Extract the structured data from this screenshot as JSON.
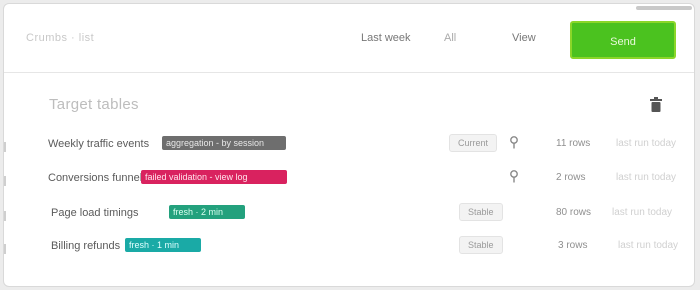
{
  "header": {
    "breadcrumb": "Crumbs · list",
    "item_a": "Last week",
    "item_b": "All",
    "item_c": "View",
    "primary_label": "Send"
  },
  "section": {
    "title": "Target tables"
  },
  "rows": [
    {
      "name": "Weekly traffic events",
      "tag": "aggregation - by session",
      "tag_color": "#6e6e6e",
      "pill": "Current",
      "value": "11 rows",
      "extra": "last run today"
    },
    {
      "name": "Conversions funnel",
      "tag": "failed validation - view log",
      "tag_color": "#d9225f",
      "pill": "",
      "value": "2 rows",
      "extra": "last run today"
    },
    {
      "name": "Page load timings",
      "tag": "fresh · 2 min",
      "tag_color": "#23a17d",
      "pill": "Stable",
      "value": "80 rows",
      "extra": "last run today"
    },
    {
      "name": "Billing refunds",
      "tag": "fresh · 1 min",
      "tag_color": "#1aaaa6",
      "pill": "Stable",
      "value": "3 rows",
      "extra": "last run today"
    }
  ]
}
